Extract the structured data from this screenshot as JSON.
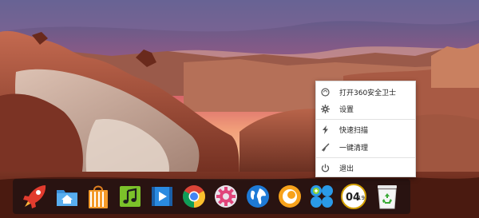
{
  "desktop": {
    "wallpaper": "sandstone-hoodoos-sunset"
  },
  "dock": {
    "items": [
      {
        "name": "rocket-launcher",
        "icon": "rocket-icon"
      },
      {
        "name": "home-folder",
        "icon": "home-folder-icon"
      },
      {
        "name": "app-store",
        "icon": "shopping-bag-icon"
      },
      {
        "name": "music-player",
        "icon": "music-note-icon"
      },
      {
        "name": "video-player",
        "icon": "film-play-icon"
      },
      {
        "name": "chrome-browser",
        "icon": "chrome-icon"
      },
      {
        "name": "system-settings",
        "icon": "gear-icon"
      },
      {
        "name": "internet-browser",
        "icon": "globe-icon"
      },
      {
        "name": "media-app",
        "icon": "orange-circle-icon"
      },
      {
        "name": "security-guard-360",
        "icon": "blue-dots-icon"
      },
      {
        "name": "clock",
        "icon": "clock-icon",
        "time_hour": "04",
        "time_min": "19"
      },
      {
        "name": "trash",
        "icon": "recycle-bin-icon"
      }
    ]
  },
  "context_menu": {
    "items": [
      {
        "label": "打开360安全卫士",
        "icon": "360-icon"
      },
      {
        "label": "设置",
        "icon": "gear-icon"
      },
      {
        "label": "快速扫描",
        "icon": "lightning-icon"
      },
      {
        "label": "一键清理",
        "icon": "broom-icon"
      },
      {
        "label": "退出",
        "icon": "power-icon"
      }
    ]
  },
  "colors": {
    "sky_top": "#5b6fa0",
    "sky_glow": "#e06a5a",
    "rock": "#9c4a35",
    "dock_bg": "#101014",
    "menu_bg": "#ffffff"
  }
}
